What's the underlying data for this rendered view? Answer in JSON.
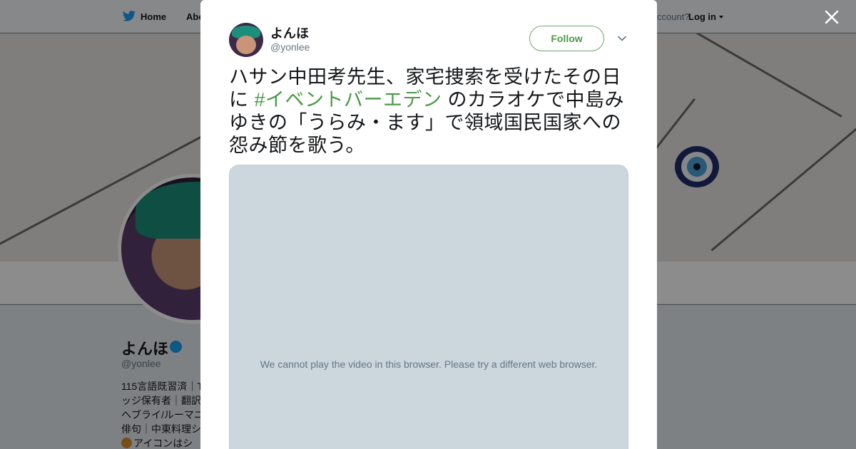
{
  "nav": {
    "home_label": "Home",
    "about_label": "Abo",
    "account_prompt": "ccount?",
    "login_label": "Log in"
  },
  "profile": {
    "name": "よんほ",
    "handle": "@yonlee",
    "bio_lines": [
      "115言語既習済｜T",
      "ッジ保有者｜翻訳",
      "ヘブライ/ルーマニ",
      "俳句｜中東料理シ",
      "アイコンはシ"
    ]
  },
  "tweet": {
    "author_name": "よんほ",
    "author_handle": "@yonlee",
    "follow_label": "Follow",
    "text_before": "ハサン中田考先生、家宅捜索を受けたその日に ",
    "hashtag": "#イベントバーエデン",
    "text_after": " のカラオケで中島みゆきの「うらみ・ます」で領域国民国家への怨み節を歌う。",
    "video_message": "We cannot play the video in this browser. Please try a different web browser."
  },
  "colors": {
    "accent_green": "#4a9a45",
    "twitter_blue": "#1da1f2",
    "overlay": "rgba(0,0,0,0.45)"
  },
  "icons": {
    "nav_logo": "twitter-bird-icon",
    "close": "close-icon",
    "menu": "chevron-down-icon",
    "verified": "globe-verified-icon",
    "bio_emoji": "emoji-icon"
  }
}
